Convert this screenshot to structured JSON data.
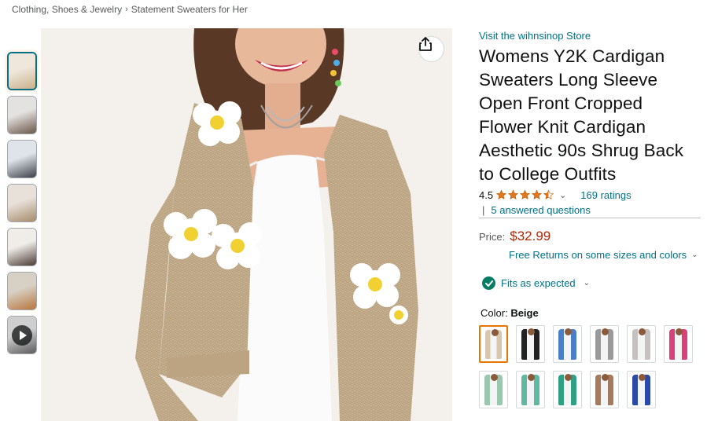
{
  "breadcrumb": {
    "items": [
      "Clothing, Shoes & Jewelry",
      "Statement Sweaters for Her"
    ],
    "separator": "›"
  },
  "product": {
    "store_link": "Visit the wihnsinop Store",
    "title": "Womens Y2K Cardigan Sweaters Long Sleeve Open Front Cropped Flower Knit Cardigan Aesthetic 90s Shrug Back to College Outfits",
    "rating_value": "4.5",
    "rating_stars": 4.5,
    "ratings_count": "169 ratings",
    "qa_separator": "|",
    "answered_questions": "5 answered questions",
    "price_label": "Price:",
    "price": "$32.99",
    "returns_text": "Free Returns on some sizes and colors",
    "fit_text": "Fits as expected",
    "color_label": "Color:",
    "color_value": "Beige"
  },
  "thumbnails": [
    {
      "name": "thumb-1",
      "colors": [
        "#efe7dc",
        "#c9b08a"
      ],
      "active": true
    },
    {
      "name": "thumb-2",
      "colors": [
        "#e4e2e0",
        "#6a5548"
      ],
      "active": false
    },
    {
      "name": "thumb-3",
      "colors": [
        "#dfe4ea",
        "#3c3f47"
      ],
      "active": false
    },
    {
      "name": "thumb-4",
      "colors": [
        "#e8e1da",
        "#a58a6a"
      ],
      "active": false
    },
    {
      "name": "thumb-5",
      "colors": [
        "#f0ede9",
        "#4a3b33"
      ],
      "active": false
    },
    {
      "name": "thumb-6",
      "colors": [
        "#d7d0c4",
        "#b8763d"
      ],
      "active": false
    },
    {
      "name": "thumb-video",
      "colors": [
        "#cfcfcf",
        "#5b5b5b"
      ],
      "active": false,
      "video": true
    }
  ],
  "swatches": [
    {
      "name": "beige",
      "color": "#d9c7ad",
      "selected": true
    },
    {
      "name": "black",
      "color": "#222222",
      "selected": false
    },
    {
      "name": "blue",
      "color": "#4a7fc8",
      "selected": false
    },
    {
      "name": "grey",
      "color": "#9a9a9a",
      "selected": false
    },
    {
      "name": "light-grey",
      "color": "#c6c1c1",
      "selected": false
    },
    {
      "name": "pink",
      "color": "#d8417a",
      "selected": false
    },
    {
      "name": "light-green",
      "color": "#9bc7b0",
      "selected": false
    },
    {
      "name": "mint",
      "color": "#5fb8a2",
      "selected": false
    },
    {
      "name": "teal",
      "color": "#2f9f86",
      "selected": false
    },
    {
      "name": "brown",
      "color": "#a87a5c",
      "selected": false
    },
    {
      "name": "royal-blue",
      "color": "#2a49a8",
      "selected": false
    }
  ],
  "icons": {
    "share": "share-icon",
    "check": "check-circle-icon",
    "play": "play-icon"
  },
  "colors": {
    "link": "#007185",
    "price": "#b12704",
    "star": "#de7921",
    "check": "#067d62",
    "selected_border": "#e77600"
  }
}
